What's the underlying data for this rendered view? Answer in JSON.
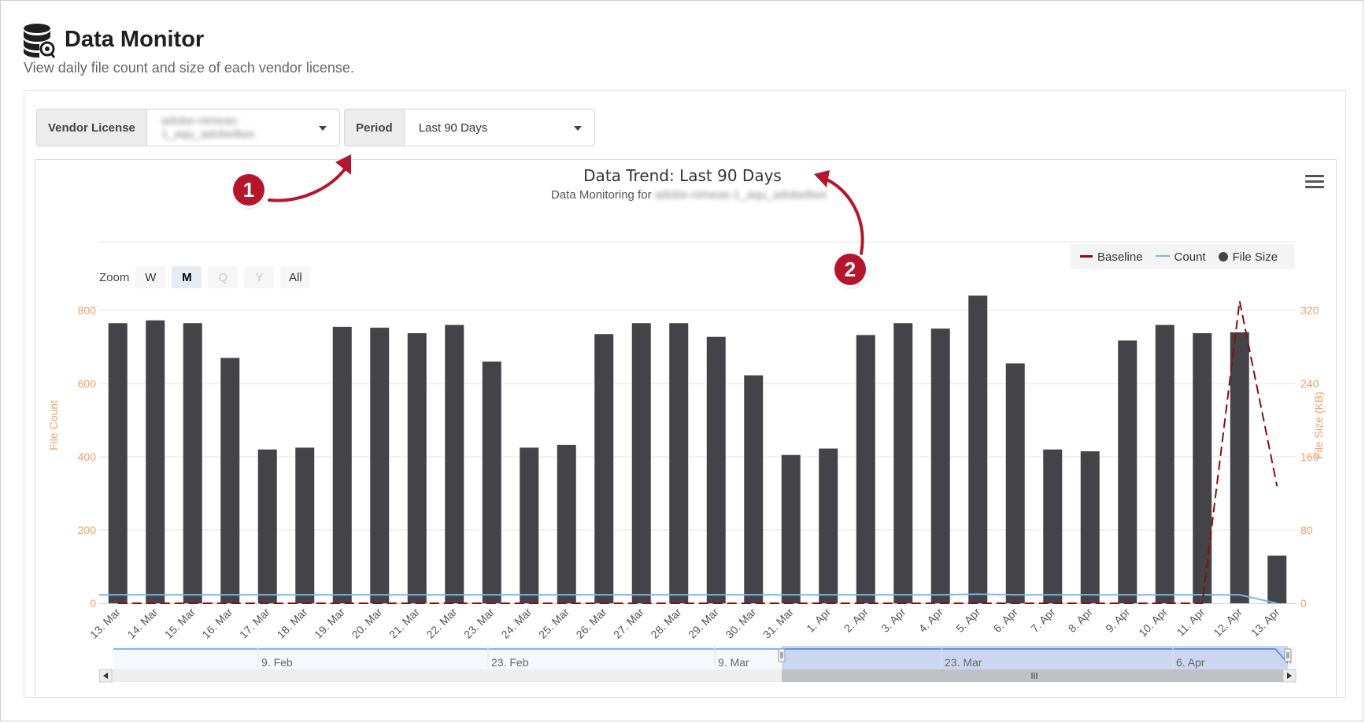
{
  "header": {
    "title": "Data Monitor",
    "subtitle": "View daily file count and size of each vendor license."
  },
  "filters": {
    "vendor_license_label": "Vendor License",
    "vendor_license_value": "adobe-nimeas-1_aqu_adobe8ws",
    "period_label": "Period",
    "period_value": "Last 90 Days"
  },
  "chart_header": {
    "title": "Data Trend: Last 90 Days",
    "subtitle_prefix": "Data Monitoring for",
    "subtitle_value": "adobe-nimeas-1_aqu_adobe8ws"
  },
  "zoom": {
    "label": "Zoom",
    "buttons": [
      "W",
      "M",
      "Q",
      "Y",
      "All"
    ],
    "active": "M",
    "disabled": [
      "Q",
      "Y"
    ]
  },
  "legend": {
    "baseline": "Baseline",
    "count": "Count",
    "file_size": "File Size"
  },
  "callouts": [
    "1",
    "2"
  ],
  "colors": {
    "bar": "#434348",
    "baseline": "#8b0d12",
    "count": "#7cb5ec",
    "axis": "#f0a068",
    "callout": "#b5162c"
  },
  "chart_data": {
    "type": "bar",
    "categories": [
      "13. Mar",
      "14. Mar",
      "15. Mar",
      "16. Mar",
      "17. Mar",
      "18. Mar",
      "19. Mar",
      "20. Mar",
      "21. Mar",
      "22. Mar",
      "23. Mar",
      "24. Mar",
      "25. Mar",
      "26. Mar",
      "27. Mar",
      "28. Mar",
      "29. Mar",
      "30. Mar",
      "31. Mar",
      "1. Apr",
      "2. Apr",
      "3. Apr",
      "4. Apr",
      "5. Apr",
      "6. Apr",
      "7. Apr",
      "8. Apr",
      "9. Apr",
      "10. Apr",
      "11. Apr",
      "12. Apr",
      "13. Apr"
    ],
    "series": [
      {
        "name": "File Size",
        "axis": "right",
        "values": [
          306,
          309,
          306,
          268,
          168,
          170,
          302,
          301,
          295,
          304,
          264,
          170,
          173,
          294,
          306,
          306,
          291,
          249,
          162,
          169,
          293,
          306,
          300,
          336,
          262,
          168,
          166,
          287,
          304,
          295,
          296,
          52
        ]
      },
      {
        "name": "Count",
        "axis": "left",
        "values": [
          23,
          23,
          23,
          23,
          23,
          23,
          23,
          23,
          23,
          23,
          23,
          23,
          23,
          23,
          23,
          23,
          23,
          23,
          23,
          23,
          23,
          23,
          23,
          25,
          23,
          23,
          23,
          23,
          23,
          23,
          23,
          0
        ]
      },
      {
        "name": "Baseline",
        "axis": "left",
        "style": "dashed",
        "values": [
          0,
          0,
          0,
          0,
          0,
          0,
          0,
          0,
          0,
          0,
          0,
          0,
          0,
          0,
          0,
          0,
          0,
          0,
          0,
          0,
          0,
          0,
          0,
          0,
          0,
          0,
          0,
          0,
          0,
          0,
          825,
          320
        ]
      }
    ],
    "ylabel_left": "File Count",
    "ylabel_right": "File Size (KB)",
    "ylim_left": [
      0,
      800
    ],
    "ylim_right": [
      0,
      320
    ],
    "yticks_left": [
      "0",
      "200",
      "400",
      "600",
      "800"
    ],
    "yticks_right": [
      "0",
      "80",
      "160",
      "240",
      "320"
    ],
    "navigator_labels": [
      "9. Feb",
      "23. Feb",
      "9. Mar",
      "23. Mar",
      "6. Apr"
    ],
    "navigator_range": [
      "13. Mar",
      "13. Apr"
    ],
    "grid": true,
    "legend_position": "top-right"
  }
}
